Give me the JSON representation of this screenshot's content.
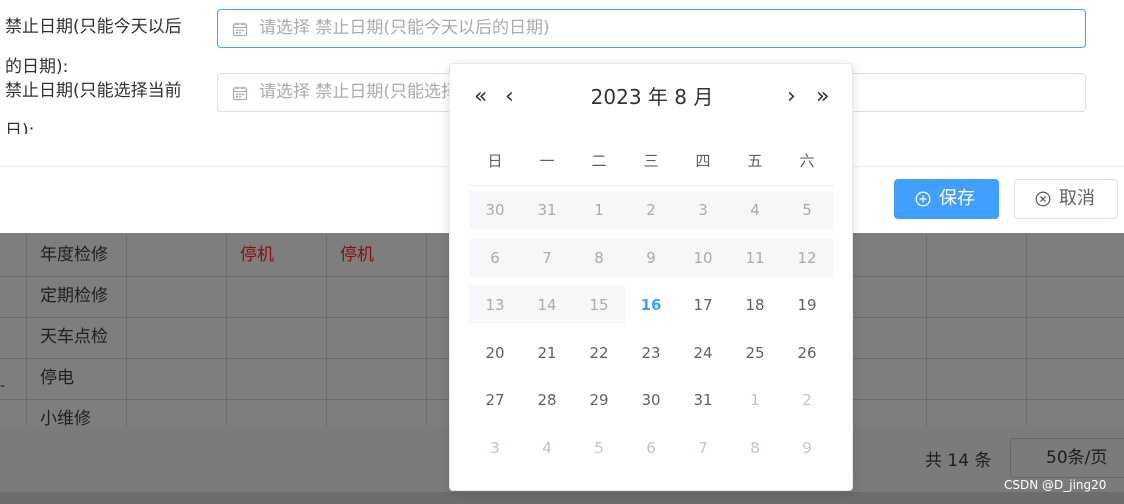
{
  "form": {
    "field1": {
      "label_line1": "禁止日期(只能今天以后",
      "label_line2": "的日期):",
      "placeholder": "请选择 禁止日期(只能今天以后的日期)"
    },
    "field2": {
      "label_line1": "禁止日期(只能选择当前",
      "label_line2": "日):",
      "placeholder": "请选择 禁止日期(只能选择"
    }
  },
  "footer": {
    "save_label": "保存",
    "cancel_label": "取消"
  },
  "picker": {
    "prev_year": "«",
    "prev_month": "‹",
    "next_month": "›",
    "next_year": "»",
    "title": "2023 年  8 月",
    "weekdays": [
      "日",
      "一",
      "二",
      "三",
      "四",
      "五",
      "六"
    ],
    "weeks": [
      [
        {
          "d": "30",
          "s": "disabled"
        },
        {
          "d": "31",
          "s": "disabled"
        },
        {
          "d": "1",
          "s": "disabled"
        },
        {
          "d": "2",
          "s": "disabled"
        },
        {
          "d": "3",
          "s": "disabled"
        },
        {
          "d": "4",
          "s": "disabled"
        },
        {
          "d": "5",
          "s": "disabled"
        }
      ],
      [
        {
          "d": "6",
          "s": "disabled"
        },
        {
          "d": "7",
          "s": "disabled"
        },
        {
          "d": "8",
          "s": "disabled"
        },
        {
          "d": "9",
          "s": "disabled"
        },
        {
          "d": "10",
          "s": "disabled"
        },
        {
          "d": "11",
          "s": "disabled"
        },
        {
          "d": "12",
          "s": "disabled"
        }
      ],
      [
        {
          "d": "13",
          "s": "disabled"
        },
        {
          "d": "14",
          "s": "disabled"
        },
        {
          "d": "15",
          "s": "disabled"
        },
        {
          "d": "16",
          "s": "today"
        },
        {
          "d": "17",
          "s": "normal"
        },
        {
          "d": "18",
          "s": "normal"
        },
        {
          "d": "19",
          "s": "normal"
        }
      ],
      [
        {
          "d": "20",
          "s": "normal"
        },
        {
          "d": "21",
          "s": "normal"
        },
        {
          "d": "22",
          "s": "normal"
        },
        {
          "d": "23",
          "s": "normal"
        },
        {
          "d": "24",
          "s": "normal"
        },
        {
          "d": "25",
          "s": "normal"
        },
        {
          "d": "26",
          "s": "normal"
        }
      ],
      [
        {
          "d": "27",
          "s": "normal"
        },
        {
          "d": "28",
          "s": "normal"
        },
        {
          "d": "29",
          "s": "normal"
        },
        {
          "d": "30",
          "s": "normal"
        },
        {
          "d": "31",
          "s": "normal"
        },
        {
          "d": "1",
          "s": "other"
        },
        {
          "d": "2",
          "s": "other"
        }
      ],
      [
        {
          "d": "3",
          "s": "other"
        },
        {
          "d": "4",
          "s": "other"
        },
        {
          "d": "5",
          "s": "other"
        },
        {
          "d": "6",
          "s": "other"
        },
        {
          "d": "7",
          "s": "other"
        },
        {
          "d": "8",
          "s": "other"
        },
        {
          "d": "9",
          "s": "other"
        }
      ]
    ]
  },
  "table": {
    "rows": [
      {
        "name": "年度检修",
        "c2": "停机",
        "c3": "停机"
      },
      {
        "name": "定期检修",
        "c2": "",
        "c3": ""
      },
      {
        "name": "天车点检",
        "c2": "",
        "c3": ""
      },
      {
        "name": "停电",
        "c2": "",
        "c3": ""
      },
      {
        "name": "小维修",
        "c2": "",
        "c3": ""
      }
    ],
    "left_marker": "-"
  },
  "pagination": {
    "total": "共 14 条",
    "page_size": "50条/页"
  },
  "watermark": "CSDN @D_jing20",
  "colors": {
    "primary": "#409eff",
    "red_text": "#8a0d0d",
    "disabled_bg": "#f5f7fa"
  }
}
